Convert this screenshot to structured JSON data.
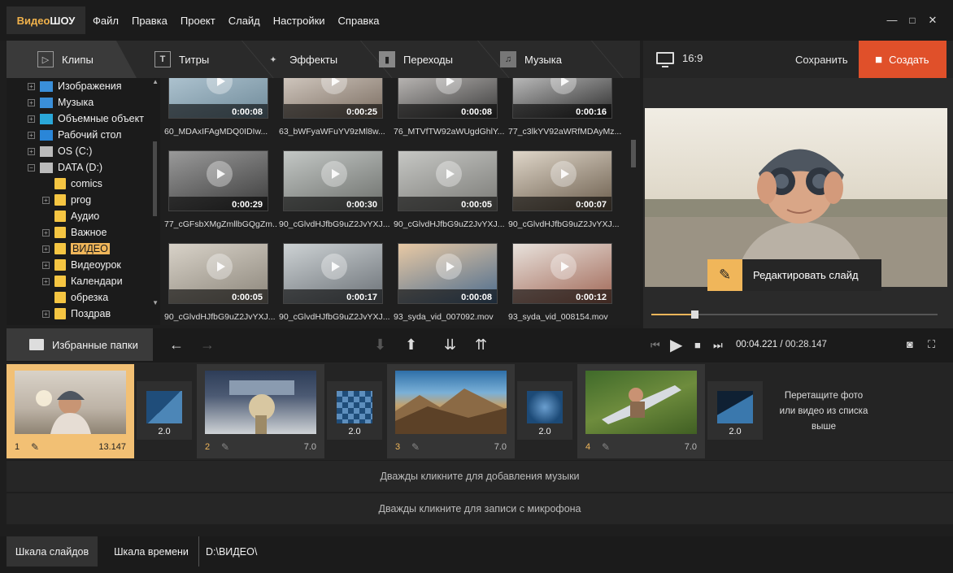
{
  "app": {
    "logo_part1": "Видео",
    "logo_part2": "ШОУ"
  },
  "menu": [
    "Файл",
    "Правка",
    "Проект",
    "Слайд",
    "Настройки",
    "Справка"
  ],
  "window_controls": [
    "—",
    "□",
    "✕"
  ],
  "tabs": [
    {
      "label": "Клипы",
      "icon": "play-icon"
    },
    {
      "label": "Титры",
      "icon": "text-icon"
    },
    {
      "label": "Эффекты",
      "icon": "magic-wand-icon"
    },
    {
      "label": "Переходы",
      "icon": "film-icon"
    },
    {
      "label": "Музыка",
      "icon": "music-note-icon"
    }
  ],
  "preview_header": {
    "ratio": "16:9",
    "save": "Сохранить",
    "create": "Создать"
  },
  "tree": [
    {
      "label": "Изображения",
      "expander": "+",
      "icon": "images"
    },
    {
      "label": "Музыка",
      "expander": "+",
      "icon": "music"
    },
    {
      "label": "Объемные объект",
      "expander": "+",
      "icon": "cube"
    },
    {
      "label": "Рабочий стол",
      "expander": "+",
      "icon": "desktop"
    },
    {
      "label": "OS (C:)",
      "expander": "+",
      "icon": "drive"
    },
    {
      "label": "DATA (D:)",
      "expander": "−",
      "icon": "drive"
    },
    {
      "label": "comics",
      "expander": "",
      "icon": "folder"
    },
    {
      "label": "prog",
      "expander": "+",
      "icon": "folder"
    },
    {
      "label": "Аудио",
      "expander": "",
      "icon": "folder"
    },
    {
      "label": "Важное",
      "expander": "+",
      "icon": "folder"
    },
    {
      "label": "ВИДЕО",
      "expander": "+",
      "icon": "folder",
      "selected": true
    },
    {
      "label": "Видеоурок",
      "expander": "+",
      "icon": "folder"
    },
    {
      "label": "Календари",
      "expander": "+",
      "icon": "folder"
    },
    {
      "label": "обрезка",
      "expander": "",
      "icon": "folder"
    },
    {
      "label": "Поздрав",
      "expander": "+",
      "icon": "folder"
    }
  ],
  "clips": [
    {
      "name": "60_MDAxIFAgMDQ0IDIw...",
      "dur": "0:00:08"
    },
    {
      "name": "63_bWFyaWFuYV9zMl8w...",
      "dur": "0:00:25"
    },
    {
      "name": "76_MTVfTW92aWUgdGhlY...",
      "dur": "0:00:08"
    },
    {
      "name": "77_c3lkYV92aWRfMDAyMz...",
      "dur": "0:00:16"
    },
    {
      "name": "77_cGFsbXMgZmllbGQgZm...",
      "dur": "0:00:29"
    },
    {
      "name": "90_cGlvdHJfbG9uZ2JvYXJ...",
      "dur": "0:00:30"
    },
    {
      "name": "90_cGlvdHJfbG9uZ2JvYXJ...",
      "dur": "0:00:05"
    },
    {
      "name": "90_cGlvdHJfbG9uZ2JvYXJ...",
      "dur": "0:00:07"
    },
    {
      "name": "90_cGlvdHJfbG9uZ2JvYXJ...",
      "dur": "0:00:05"
    },
    {
      "name": "90_cGlvdHJfbG9uZ2JvYXJ...",
      "dur": "0:00:17"
    },
    {
      "name": "93_syda_vid_007092.mov",
      "dur": "0:00:08"
    },
    {
      "name": "93_syda_vid_008154.mov",
      "dur": "0:00:12"
    }
  ],
  "preview": {
    "edit_slide": "Редактировать слайд",
    "progress": 0.15
  },
  "controls": {
    "favorites": "Избранные папки",
    "time_current": "00:04.221",
    "time_sep": " / ",
    "time_total": "00:28.147"
  },
  "slides": [
    {
      "num": "1",
      "dur": "13.147",
      "selected": true
    },
    {
      "num": "2",
      "dur": "7.0"
    },
    {
      "num": "3",
      "dur": "7.0"
    },
    {
      "num": "4",
      "dur": "7.0"
    }
  ],
  "transitions": [
    "2.0",
    "2.0",
    "2.0",
    "2.0"
  ],
  "drop_hint": "Перетащите фото или видео из списка выше",
  "tracks": {
    "music": "Дважды кликните для добавления музыки",
    "mic": "Дважды кликните для записи с микрофона"
  },
  "bottom": {
    "tab1": "Шкала слайдов",
    "tab2": "Шкала времени",
    "path": "D:\\ВИДЕО\\"
  },
  "colors": {
    "accent": "#f0b65a",
    "create": "#e0502a",
    "folder": "#f5c542"
  }
}
